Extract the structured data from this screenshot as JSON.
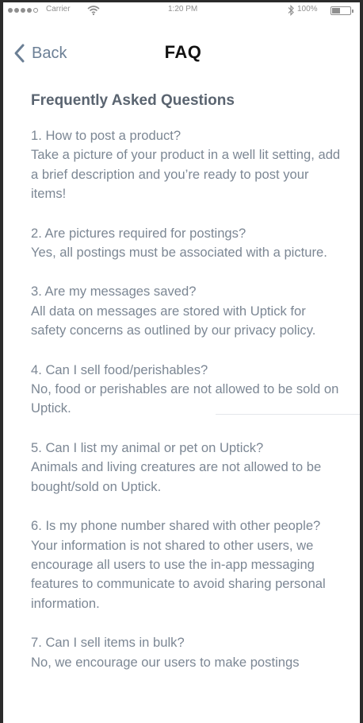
{
  "status_bar": {
    "carrier": "Carrier",
    "time": "1:20 PM",
    "battery_percent": "100%",
    "signal_icon": "signal-dots-icon",
    "wifi_icon": "wifi-icon",
    "bluetooth_icon": "bluetooth-icon",
    "battery_icon": "battery-icon",
    "battery_level": 0.45
  },
  "nav": {
    "back_label": "Back",
    "title": "FAQ"
  },
  "faq": {
    "heading": "Frequently Asked Questions",
    "items": [
      {
        "q": "1. How to post a product?",
        "a": "Take a picture of your product in a well lit setting, add a brief description and you’re ready to post your items!"
      },
      {
        "q": "2. Are pictures required for postings?",
        "a": "Yes, all postings must be associated with a picture."
      },
      {
        "q": "3. Are my messages saved?",
        "a": "All data on messages are stored with Uptick for safety concerns as outlined by our privacy policy."
      },
      {
        "q": "4. Can I sell food/perishables?",
        "a": "No, food or perishables are not allowed to be sold on Uptick."
      },
      {
        "q": "5. Can I list my animal or pet on Uptick?",
        "a": "Animals and living creatures are not allowed to be bought/sold on Uptick."
      },
      {
        "q": "6. Is my phone number shared with other people?",
        "a": "Your information is not shared to other users, we encourage all users to use the in-app messaging features to communicate to avoid sharing personal information."
      },
      {
        "q": "7. Can I sell items in bulk?",
        "a": "No, we encourage our users to make postings"
      }
    ]
  },
  "colors": {
    "text": "#7c8794",
    "heading": "#5a6470",
    "accent": "#6b7f95"
  }
}
